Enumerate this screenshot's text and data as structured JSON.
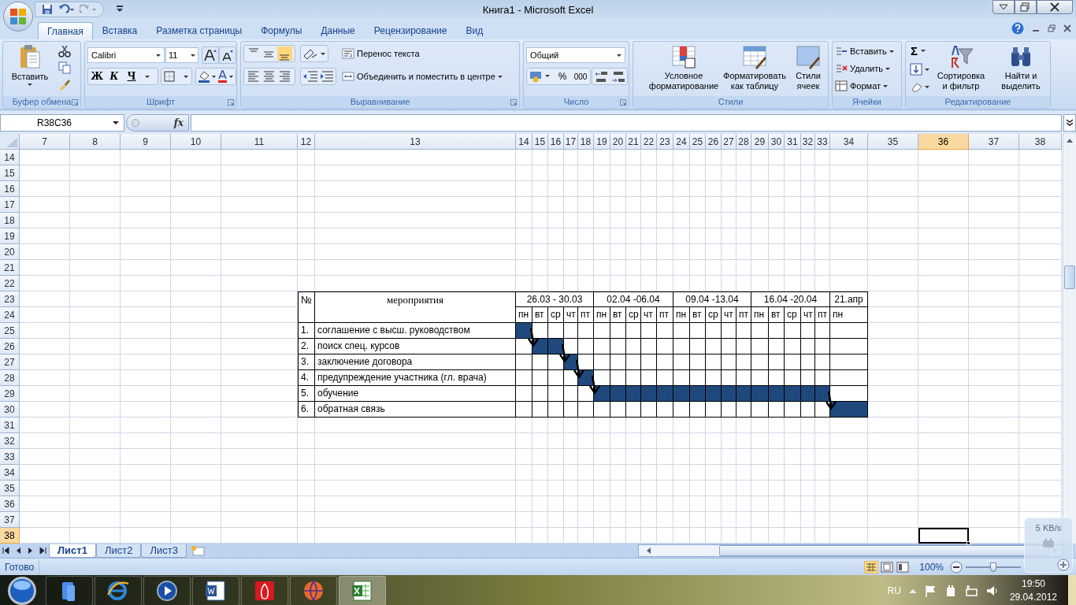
{
  "window": {
    "title": "Книга1 - Microsoft Excel"
  },
  "ribbon_tabs": [
    {
      "label": "Главная",
      "selected": true
    },
    {
      "label": "Вставка",
      "selected": false
    },
    {
      "label": "Разметка страницы",
      "selected": false
    },
    {
      "label": "Формулы",
      "selected": false
    },
    {
      "label": "Данные",
      "selected": false
    },
    {
      "label": "Рецензирование",
      "selected": false
    },
    {
      "label": "Вид",
      "selected": false
    }
  ],
  "ribbon": {
    "clipboard": {
      "paste": "Вставить",
      "label": "Буфер обмена"
    },
    "font": {
      "name": "Calibri",
      "size": "11",
      "bold": "Ж",
      "italic": "К",
      "underline": "Ч",
      "label": "Шрифт"
    },
    "alignment": {
      "wrap": "Перенос текста",
      "merge": "Объединить и поместить в центре",
      "label": "Выравнивание"
    },
    "number": {
      "format": "Общий",
      "percent": "%",
      "thousands": "000",
      "label": "Число"
    },
    "styles": {
      "conditional": "Условное\nформатирование",
      "as_table": "Форматировать\nкак таблицу",
      "cell_styles": "Стили\nячеек",
      "label": "Стили"
    },
    "cells": {
      "insert": "Вставить",
      "delete": "Удалить",
      "format": "Формат",
      "label": "Ячейки"
    },
    "editing": {
      "sum": "Σ",
      "sort": "Сортировка\nи фильтр",
      "find": "Найти и\nвыделить",
      "label": "Редактирование"
    }
  },
  "formula_bar": {
    "name_box": "R38C36",
    "fx": "fx"
  },
  "columns": [
    {
      "label": "7",
      "selected": false
    },
    {
      "label": "8",
      "selected": false
    },
    {
      "label": "9",
      "selected": false
    },
    {
      "label": "10",
      "selected": false
    },
    {
      "label": "11",
      "selected": false
    },
    {
      "label": "12",
      "selected": false
    },
    {
      "label": "13",
      "selected": false
    },
    {
      "label": "14",
      "selected": false
    },
    {
      "label": "15",
      "selected": false
    },
    {
      "label": "16",
      "selected": false
    },
    {
      "label": "17",
      "selected": false
    },
    {
      "label": "18",
      "selected": false
    },
    {
      "label": "19",
      "selected": false
    },
    {
      "label": "20",
      "selected": false
    },
    {
      "label": "21",
      "selected": false
    },
    {
      "label": "22",
      "selected": false
    },
    {
      "label": "23",
      "selected": false
    },
    {
      "label": "24",
      "selected": false
    },
    {
      "label": "25",
      "selected": false
    },
    {
      "label": "26",
      "selected": false
    },
    {
      "label": "27",
      "selected": false
    },
    {
      "label": "28",
      "selected": false
    },
    {
      "label": "29",
      "selected": false
    },
    {
      "label": "30",
      "selected": false
    },
    {
      "label": "31",
      "selected": false
    },
    {
      "label": "32",
      "selected": false
    },
    {
      "label": "33",
      "selected": false
    },
    {
      "label": "34",
      "selected": false
    },
    {
      "label": "35",
      "selected": false
    },
    {
      "label": "36",
      "selected": true
    },
    {
      "label": "37",
      "selected": false
    },
    {
      "label": "38",
      "selected": false
    }
  ],
  "rows": [
    {
      "label": "14",
      "selected": false
    },
    {
      "label": "15",
      "selected": false
    },
    {
      "label": "16",
      "selected": false
    },
    {
      "label": "17",
      "selected": false
    },
    {
      "label": "18",
      "selected": false
    },
    {
      "label": "19",
      "selected": false
    },
    {
      "label": "20",
      "selected": false
    },
    {
      "label": "21",
      "selected": false
    },
    {
      "label": "22",
      "selected": false
    },
    {
      "label": "23",
      "selected": false
    },
    {
      "label": "24",
      "selected": false
    },
    {
      "label": "25",
      "selected": false
    },
    {
      "label": "26",
      "selected": false
    },
    {
      "label": "27",
      "selected": false
    },
    {
      "label": "28",
      "selected": false
    },
    {
      "label": "29",
      "selected": false
    },
    {
      "label": "30",
      "selected": false
    },
    {
      "label": "31",
      "selected": false
    },
    {
      "label": "32",
      "selected": false
    },
    {
      "label": "33",
      "selected": false
    },
    {
      "label": "34",
      "selected": false
    },
    {
      "label": "35",
      "selected": false
    },
    {
      "label": "36",
      "selected": false
    },
    {
      "label": "37",
      "selected": false
    },
    {
      "label": "38",
      "selected": true
    }
  ],
  "table": {
    "number_header": "№",
    "name_header": "мероприятия",
    "weeks": [
      "26.03 - 30.03",
      "02.04 -06.04",
      "09.04 -13.04",
      "16.04 -20.04",
      "21.апр"
    ],
    "days": [
      "пн",
      "вт",
      "ср",
      "чт",
      "пт",
      "пн",
      "вт",
      "ср",
      "чт",
      "пт",
      "пн",
      "вт",
      "ср",
      "чт",
      "пт",
      "пн",
      "вт",
      "ср",
      "чт",
      "пт",
      "пн"
    ],
    "tasks": [
      {
        "number": "1.",
        "name": "соглашение с высш. руководством",
        "filled": [
          true,
          false,
          false,
          false,
          false,
          false,
          false,
          false,
          false,
          false,
          false,
          false,
          false,
          false,
          false,
          false,
          false,
          false,
          false,
          false,
          false
        ],
        "arrow": true
      },
      {
        "number": "2.",
        "name": "поиск спец. курсов",
        "filled": [
          false,
          true,
          true,
          false,
          false,
          false,
          false,
          false,
          false,
          false,
          false,
          false,
          false,
          false,
          false,
          false,
          false,
          false,
          false,
          false,
          false
        ],
        "arrow": true
      },
      {
        "number": "3.",
        "name": "заключение договора",
        "filled": [
          false,
          false,
          false,
          true,
          false,
          false,
          false,
          false,
          false,
          false,
          false,
          false,
          false,
          false,
          false,
          false,
          false,
          false,
          false,
          false,
          false
        ],
        "arrow": true
      },
      {
        "number": "4.",
        "name": "предупреждение участника (гл. врача)",
        "filled": [
          false,
          false,
          false,
          false,
          true,
          false,
          false,
          false,
          false,
          false,
          false,
          false,
          false,
          false,
          false,
          false,
          false,
          false,
          false,
          false,
          false
        ],
        "arrow": true
      },
      {
        "number": "5.",
        "name": "обучение",
        "filled": [
          false,
          false,
          false,
          false,
          false,
          true,
          true,
          true,
          true,
          true,
          true,
          true,
          true,
          true,
          true,
          true,
          true,
          true,
          true,
          true,
          false
        ],
        "arrow": true
      },
      {
        "number": "6.",
        "name": "обратная связь",
        "filled": [
          false,
          false,
          false,
          false,
          false,
          false,
          false,
          false,
          false,
          false,
          false,
          false,
          false,
          false,
          false,
          false,
          false,
          false,
          false,
          false,
          true
        ],
        "arrow": false
      }
    ]
  },
  "sheet_tabs": [
    {
      "label": "Лист1",
      "selected": true
    },
    {
      "label": "Лист2",
      "selected": false
    },
    {
      "label": "Лист3",
      "selected": false
    }
  ],
  "status_bar": {
    "text": "Готово",
    "zoom": "100%",
    "zoom_slider": {
      "level": 0.5
    }
  },
  "network_widget": {
    "speed": "5 KB/s"
  },
  "taskbar": {
    "language": "RU",
    "time": "19:50",
    "date": "29.04.2012"
  }
}
